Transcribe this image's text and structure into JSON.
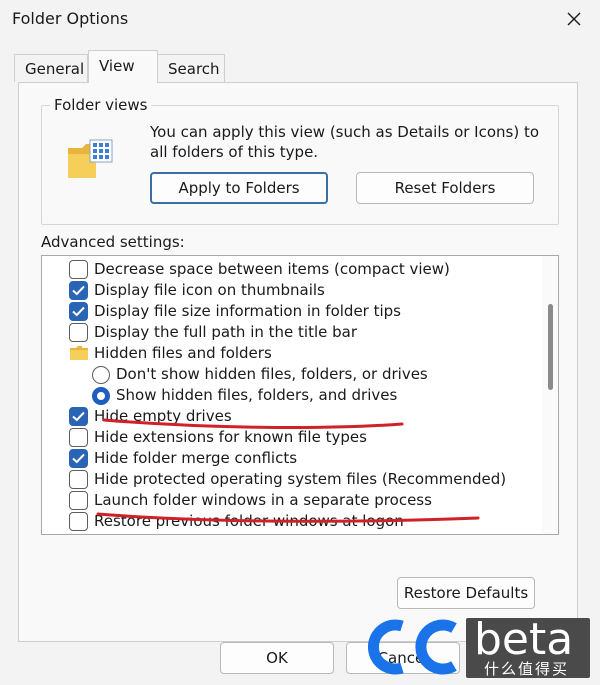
{
  "window": {
    "title": "Folder Options"
  },
  "tabs": [
    {
      "label": "General",
      "active": false
    },
    {
      "label": "View",
      "active": true
    },
    {
      "label": "Search",
      "active": false
    }
  ],
  "folder_views": {
    "legend": "Folder views",
    "description": "You can apply this view (such as Details or Icons) to all folders of this type.",
    "apply_button": "Apply to Folders",
    "reset_button": "Reset Folders"
  },
  "advanced": {
    "label": "Advanced settings:",
    "items": [
      {
        "kind": "checkbox",
        "checked": false,
        "label": "Decrease space between items (compact view)"
      },
      {
        "kind": "checkbox",
        "checked": true,
        "label": "Display file icon on thumbnails"
      },
      {
        "kind": "checkbox",
        "checked": true,
        "label": "Display file size information in folder tips"
      },
      {
        "kind": "checkbox",
        "checked": false,
        "label": "Display the full path in the title bar"
      },
      {
        "kind": "folder",
        "label": "Hidden files and folders"
      },
      {
        "kind": "radio",
        "checked": false,
        "label": "Don't show hidden files, folders, or drives"
      },
      {
        "kind": "radio",
        "checked": true,
        "label": "Show hidden files, folders, and drives"
      },
      {
        "kind": "checkbox",
        "checked": true,
        "label": "Hide empty drives"
      },
      {
        "kind": "checkbox",
        "checked": false,
        "label": "Hide extensions for known file types"
      },
      {
        "kind": "checkbox",
        "checked": true,
        "label": "Hide folder merge conflicts"
      },
      {
        "kind": "checkbox",
        "checked": false,
        "label": "Hide protected operating system files (Recommended)"
      },
      {
        "kind": "checkbox",
        "checked": false,
        "label": "Launch folder windows in a separate process"
      },
      {
        "kind": "checkbox",
        "checked": false,
        "label": "Restore previous folder windows at logon"
      }
    ]
  },
  "restore_defaults_button": "Restore Defaults",
  "ok_button": "OK",
  "cancel_button": "Cancel",
  "watermark": {
    "brand": "beta",
    "sub": "什么值得买"
  },
  "colors": {
    "accent": "#2a64b5",
    "annotation": "#d0202a",
    "watermark_blue": "#1a73e8"
  }
}
